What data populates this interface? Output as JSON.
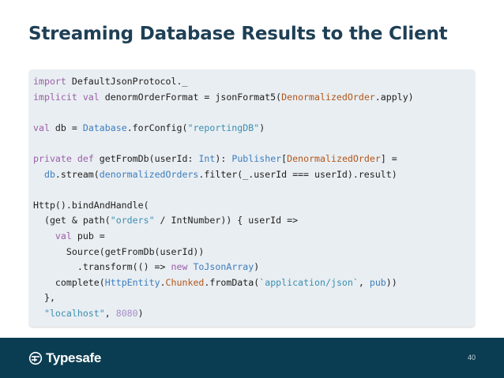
{
  "slide": {
    "title": "Streaming Database Results to the Client",
    "page_number": "40"
  },
  "code": {
    "import": "import",
    "import_target": " DefaultJsonProtocol._",
    "implicit": "implicit",
    "val": "val",
    "order_format_lhs": " denormOrderFormat = jsonFormat5(",
    "denormalized_order": "DenormalizedOrder",
    "apply_suffix": ".apply)",
    "db_lhs": " db = ",
    "database": "Database",
    "for_config": ".forConfig(",
    "reporting_db": "\"reportingDB\"",
    "close_paren": ")",
    "private": "private",
    "def": "def",
    "get_from_db_sig": " getFromDb(userId: ",
    "int_type": "Int",
    "returns": "): ",
    "publisher": "Publisher",
    "open_bracket": "[",
    "close_bracket_eq": "] =",
    "indent_db": "  db",
    "stream_call": ".stream(",
    "denormalized_orders": "denormalizedOrders",
    "filter_expr": ".filter(_.userId === userId).result)",
    "http_bind": "Http().bindAndHandle(",
    "get_path_open": "  (get & path(",
    "orders_str": "\"orders\"",
    "int_number_expr": " / IntNumber)) { userId =>",
    "pub_decl_indent": "    ",
    "pub_decl_rest": " pub =",
    "source_line": "      Source(getFromDb(userId))",
    "transform_open": "        .transform(() => ",
    "new_kw": "new",
    "space": " ",
    "to_json_array": "ToJsonArray",
    "complete_open": "    complete(",
    "http_entity": "HttpEntity",
    "dot": ".",
    "chunked": "Chunked",
    "from_data": ".fromData(",
    "content_type": "`application/json`",
    "comma": ", ",
    "pub_ref": "pub",
    "complete_close": "))",
    "close_block": "  },",
    "localhost_indent": "  ",
    "localhost_str": "\"localhost\"",
    "port": "8080"
  },
  "footer": {
    "brand": "Typesafe"
  },
  "colors": {
    "title": "#1e3f55",
    "footer_bg": "#0b3d52",
    "code_bg": "#e9eef2",
    "keyword": "#9b5fa8",
    "type": "#3d7dbd",
    "class": "#b2561a",
    "string": "#3a8fb0",
    "number": "#a58ec8"
  }
}
